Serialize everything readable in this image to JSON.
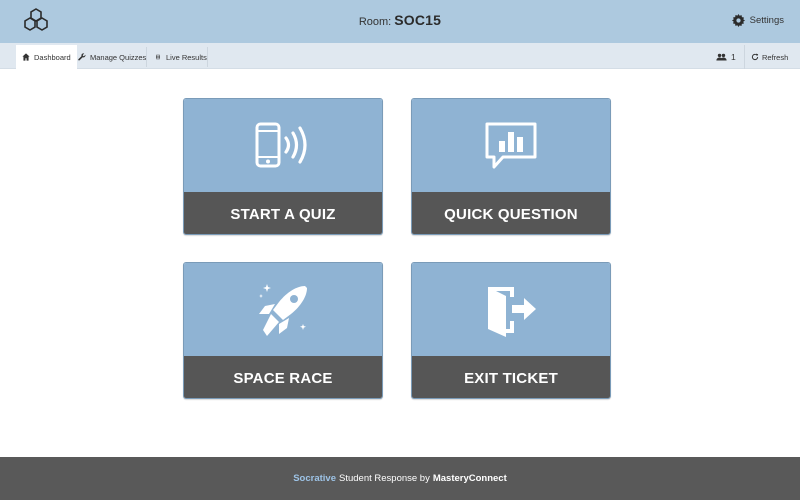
{
  "header": {
    "room_label": "Room:",
    "room_name": "SOC15",
    "settings_label": "Settings",
    "logo_icon": "hexagon-cluster-logo"
  },
  "nav": {
    "tabs": [
      {
        "label": "Dashboard",
        "icon": "home-icon",
        "active": true
      },
      {
        "label": "Manage Quizzes",
        "icon": "wrench-icon",
        "active": false
      },
      {
        "label": "Live Results",
        "icon": "signal-icon",
        "active": false
      }
    ],
    "user_count": "1",
    "refresh_label": "Refresh"
  },
  "tiles": [
    {
      "label": "START A QUIZ",
      "icon": "phone-signal-icon"
    },
    {
      "label": "QUICK QUESTION",
      "icon": "chart-bubble-icon"
    },
    {
      "label": "SPACE RACE",
      "icon": "rocket-icon"
    },
    {
      "label": "EXIT TICKET",
      "icon": "exit-door-icon"
    }
  ],
  "footer": {
    "brand": "Socrative",
    "middle": "Student Response by",
    "owner": "MasteryConnect"
  },
  "colors": {
    "header_bg": "#adc9df",
    "nav_bg": "#e0e8f0",
    "tile_top": "#8fb3d3",
    "tile_bottom": "#565656",
    "footer_bg": "#595959",
    "brand_accent": "#9dc3e6"
  }
}
